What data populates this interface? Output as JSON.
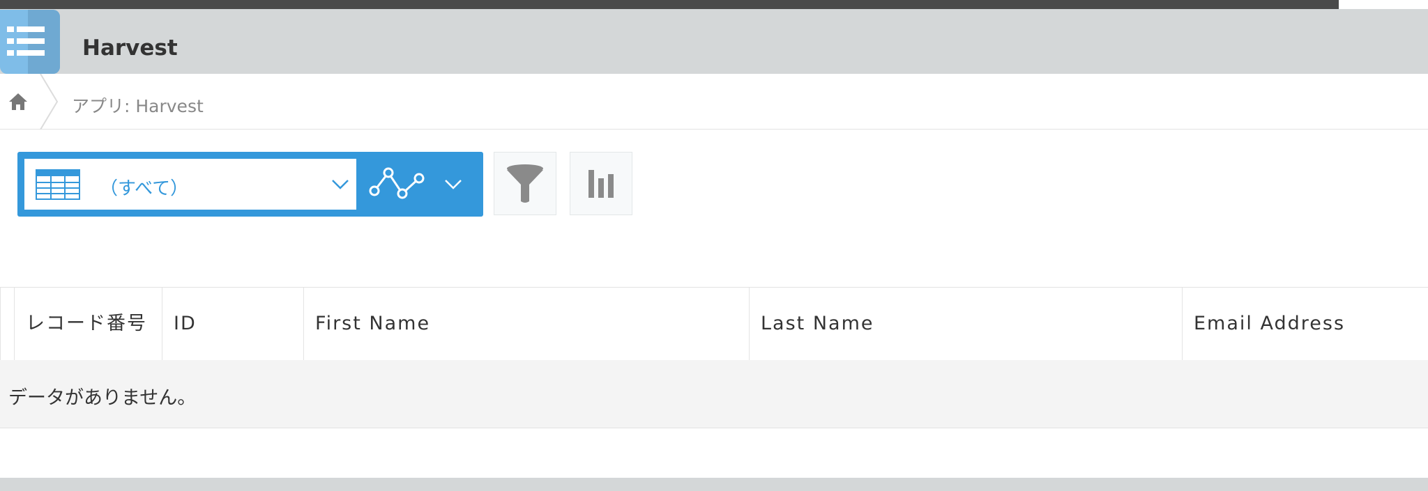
{
  "header": {
    "app_title": "Harvest",
    "app_icon": "list-icon"
  },
  "breadcrumb": {
    "home_icon": "home-icon",
    "label": "アプリ: Harvest"
  },
  "toolbar": {
    "view_selector": {
      "icon": "table-icon",
      "selected_label": "（すべて）"
    },
    "graph_selector_icon": "line-graph-icon",
    "filter_icon": "funnel-icon",
    "graph_icon": "bar-chart-icon"
  },
  "table": {
    "columns": [
      "レコード番号",
      "ID",
      "First Name",
      "Last Name",
      "Email Address"
    ],
    "empty_message": "データがありません。"
  },
  "colors": {
    "accent": "#3498db",
    "header_bg": "#d4d7d8",
    "app_icon_bg": "#7fbde8"
  }
}
